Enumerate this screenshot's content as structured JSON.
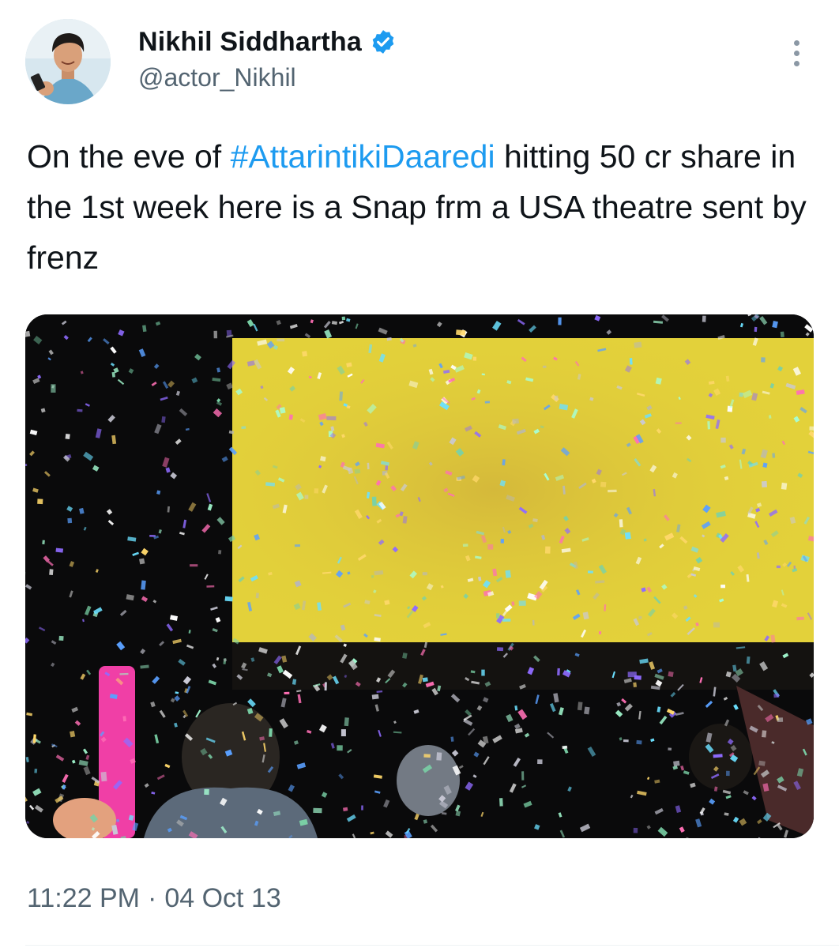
{
  "author": {
    "display_name": "Nikhil Siddhartha",
    "handle": "@actor_Nikhil",
    "verified": true,
    "verified_icon": "verified-badge-icon",
    "avatar_icon": "avatar-photo"
  },
  "tweet": {
    "text_before": "On the eve of ",
    "hashtag": "#AttarintikiDaaredi",
    "text_after": " hitting 50 cr share in the 1st week here is a Snap frm a USA theatre sent by frenz",
    "media_alt": "Confetti celebration in a movie theatre with a yellow screen"
  },
  "meta": {
    "time": "11:22 PM",
    "separator": "·",
    "date": "04 Oct 13"
  },
  "colors": {
    "text": "#0f1419",
    "secondary": "#536471",
    "link": "#1d9bf0",
    "verified": "#1d9bf0",
    "screen": "#e6d33c"
  }
}
